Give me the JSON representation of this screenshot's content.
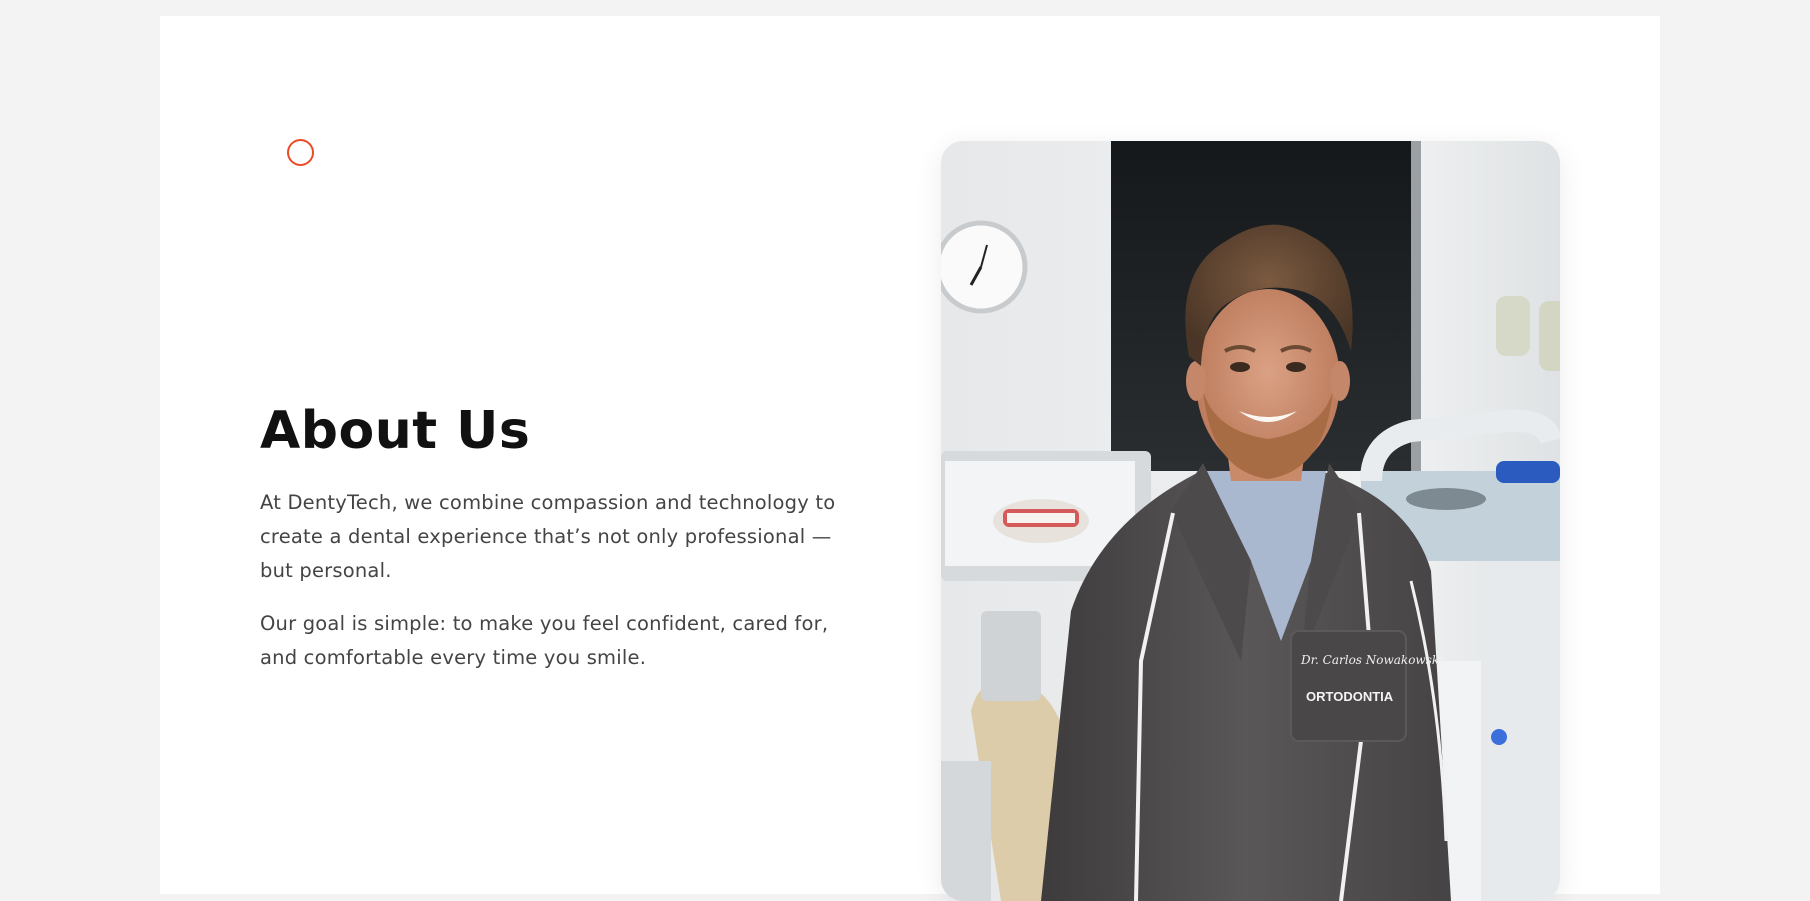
{
  "about": {
    "heading": "About Us",
    "paragraph_1": "At DentyTech, we combine compassion and technology to create a dental experience that’s not only professional — but personal.",
    "paragraph_2": "Our goal is simple: to make you feel confident, cared for, and comfortable every time you smile."
  },
  "photo": {
    "coat_name_tag": "Dr. Carlos Nowakowski",
    "coat_pocket_label": "ORTODONTIA"
  },
  "colors": {
    "accent": "#ea4d25",
    "page_background": "#f3f3f3",
    "card_background": "#ffffff",
    "heading_text": "#111111",
    "body_text": "#444444"
  },
  "icons": {
    "decor": "circle-outline-icon"
  }
}
